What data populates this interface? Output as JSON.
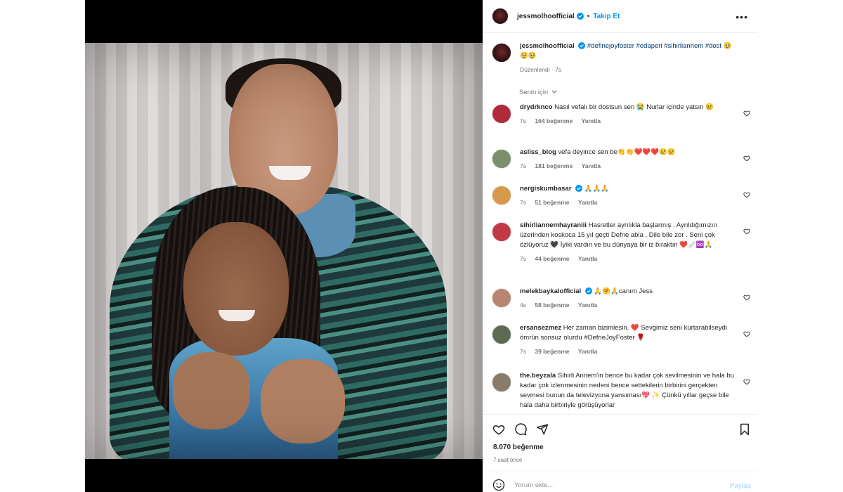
{
  "post": {
    "author": "jessmolhoofficial",
    "follow_label": "Takip Et",
    "more_label": "•••",
    "caption_username": "jessmolhoofficial",
    "caption_tags": "#definejoyfoster #edaperi #sihirliannem #dost",
    "caption_emoji": "🥹🥹🥹",
    "caption_meta": "Düzenlendi · 7s",
    "for_you_label": "Senin için",
    "likes": "8.070 beğenme",
    "time_ago": "7 saat önce"
  },
  "comments": [
    {
      "username": "drydrknco",
      "text": "Nasıl vefalı bir dostsun sen 😭 Nurlar içinde yatsın 😢",
      "time": "7s",
      "likes": "164 beğenme",
      "reply": "Yanıtla",
      "avatar_color": "#b12a3a"
    },
    {
      "username": "asliss_blog",
      "text": "vefa deyince sen be👏👏❤️❤️❤️😢😢",
      "time": "7s",
      "likes": "181 beğenme",
      "reply": "Yanıtla",
      "avatar_color": "#7a8f6a"
    },
    {
      "username": "nergiskumbasar",
      "text": "🙏🙏🙏",
      "time": "7s",
      "likes": "51 beğenme",
      "reply": "Yanıtla",
      "avatar_color": "#d79a4a"
    },
    {
      "username": "sihirliannemhayraniii",
      "text": "Hasretler ayrılıkla başlarmış . Ayrıldığımızın üzerinden koskoca 15 yıl geçti Defne abla . Dile bile zor . Seni çok özlüyoruz 🖤 İyiki vardın ve bu dünyaya bir iz bıraktın ❤️🩹♾️🙏",
      "time": "7s",
      "likes": "44 beğenme",
      "reply": "Yanıtla",
      "avatar_color": "#c23a45"
    },
    {
      "username": "melekbaykalofficial",
      "text": "🙏🤗🙏canım Jess",
      "time": "4s",
      "likes": "58 beğenme",
      "reply": "Yanıtla",
      "avatar_color": "#b88670"
    },
    {
      "username": "ersansezmez",
      "text": "Her zaman bizimlesin. ❤️ Sevgimiz seni kurtarabilseydi ömrün sonsuz olurdu #DefneJoyFoster 🌹",
      "time": "7s",
      "likes": "39 beğenme",
      "reply": "Yanıtla",
      "avatar_color": "#5f6a55"
    },
    {
      "username": "the.beyzala",
      "text": "Sihirli Annem'in bence bu kadar çok sevilmesinin ve hala bu kadar çok izlenmesinin nedeni bence settekilerin birbirini gerçekten sevmesi bunun da televizyona yansıması💖 ✨ Çünkü yıllar geçse bile hala daha birbiriyle görüşüyorlar",
      "time": "",
      "likes": "",
      "reply": "",
      "avatar_color": "#8a7a6a"
    }
  ],
  "composer": {
    "placeholder": "Yorum ekle...",
    "share_label": "Paylaş"
  },
  "icons": {
    "like": "heart-icon",
    "comment": "comment-icon",
    "share": "share-icon",
    "save": "bookmark-icon",
    "emoji": "emoji-icon",
    "more": "more-icon",
    "verified": "verified-badge-icon"
  },
  "colors": {
    "accent": "#0095f6",
    "hashtag": "#00376b",
    "muted": "#737373"
  }
}
